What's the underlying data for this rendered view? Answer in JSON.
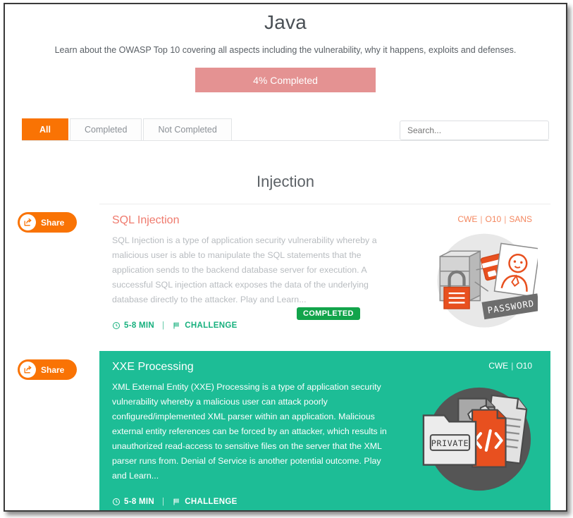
{
  "header": {
    "title": "Java",
    "subtitle": "Learn about the OWASP Top 10 covering all aspects including the vulnerability, why it happens, exploits and defenses.",
    "progress_label": "4% Completed",
    "progress_percent": 4,
    "progress_color": "#e49292"
  },
  "filters": {
    "tabs": [
      {
        "label": "All",
        "active": true
      },
      {
        "label": "Completed",
        "active": false
      },
      {
        "label": "Not Completed",
        "active": false
      }
    ],
    "search_placeholder": "Search...",
    "search_value": "",
    "active_color": "#f97304"
  },
  "sections": [
    {
      "title": "Injection",
      "cards": [
        {
          "share_label": "Share",
          "share_icon": "share-icon",
          "title": "SQL Injection",
          "description": "SQL Injection is a type of application security vulnerability whereby a malicious user is able to manipulate the SQL statements that the application sends to the backend database server for execution. A successful SQL injection attack exposes the data of the underlying database directly to the attacker. Play and Learn...",
          "duration": "5-8 MIN",
          "duration_icon": "clock-icon",
          "separator": "|",
          "challenge": "CHALLENGE",
          "challenge_icon": "flag-icon",
          "status_badge": "COMPLETED",
          "links": [
            "CWE",
            "O10",
            "SANS"
          ],
          "link_separator": "|",
          "theme": "plain",
          "accent_color": "#ef7a6d",
          "illustration": "database-lock-password-illustration"
        },
        {
          "share_label": "Share",
          "share_icon": "share-icon",
          "title": "XXE Processing",
          "description": "XML External Entity (XXE) Processing is a type of application security vulnerability whereby a malicious user can attack poorly configured/implemented XML parser within an application. Malicious external entity references can be forced by an attacker, which results in unauthorized read-access to sensitive files on the server that the XML parser runs from. Denial of Service is another potential outcome. Play and Learn...",
          "duration": "5-8 MIN",
          "duration_icon": "clock-icon",
          "separator": "|",
          "challenge": "CHALLENGE",
          "challenge_icon": "flag-icon",
          "status_badge": "",
          "links": [
            "CWE",
            "O10"
          ],
          "link_separator": "|",
          "theme": "green",
          "accent_color": "#1dbd96",
          "illustration": "private-folder-code-illustration",
          "illustration_label": "PRIVATE"
        }
      ]
    }
  ]
}
